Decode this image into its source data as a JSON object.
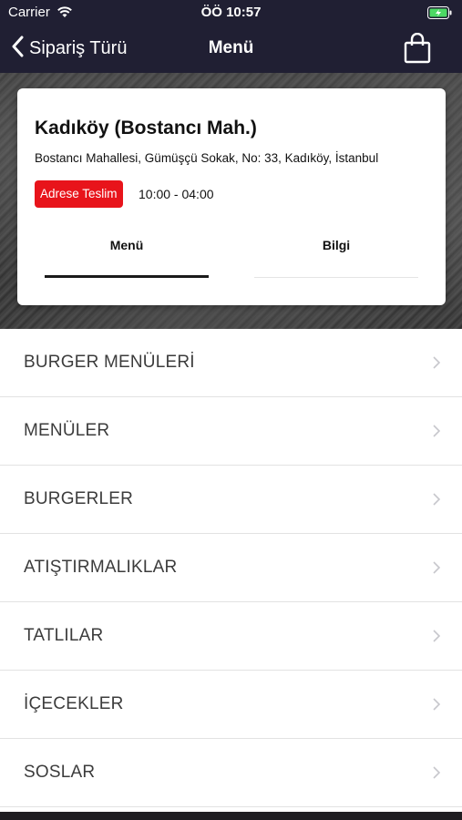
{
  "status_bar": {
    "carrier": "Carrier",
    "time": "ÖÖ 10:57"
  },
  "nav": {
    "back_label": "Sipariş Türü",
    "title": "Menü"
  },
  "store": {
    "name": "Kadıköy (Bostancı Mah.)",
    "address": "Bostancı Mahallesi, Gümüşçü Sokak, No: 33, Kadıköy, İstanbul",
    "delivery_badge": "Adrese Teslim",
    "hours": "10:00 - 04:00"
  },
  "tabs": [
    {
      "label": "Menü",
      "active": true
    },
    {
      "label": "Bilgi",
      "active": false
    }
  ],
  "categories": [
    {
      "label": "BURGER MENÜLERİ"
    },
    {
      "label": "MENÜLER"
    },
    {
      "label": "BURGERLER"
    },
    {
      "label": "ATIŞTIRMALIKLAR"
    },
    {
      "label": "TATLILAR"
    },
    {
      "label": "İÇECEKLER"
    },
    {
      "label": "SOSLAR"
    }
  ],
  "icons": {
    "wifi": "wifi-icon",
    "battery": "battery-charging-icon",
    "back": "chevron-left-icon",
    "bag": "shopping-bag-icon",
    "category_arrow": "chevron-right-icon"
  },
  "colors": {
    "nav_bg": "#201f33",
    "badge_red": "#e8141b",
    "text_dark": "#111111",
    "category_text": "#3c3c3c"
  }
}
